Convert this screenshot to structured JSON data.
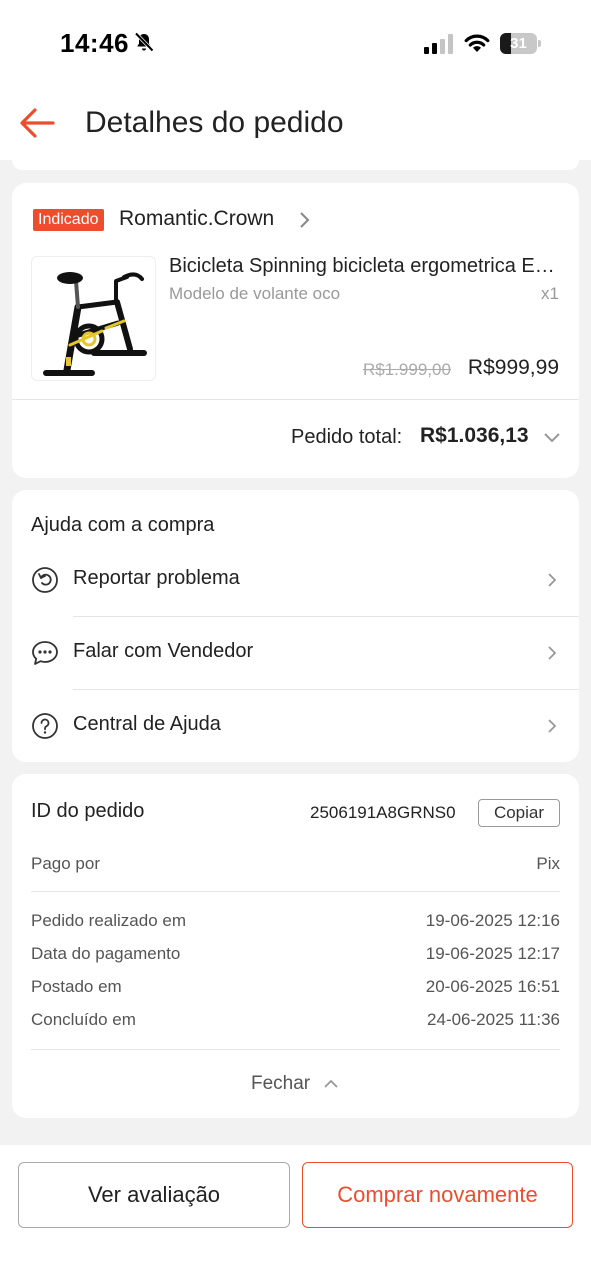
{
  "status_bar": {
    "time": "14:46",
    "battery": "31",
    "battery_level": 0.31
  },
  "header": {
    "title": "Detalhes do pedido"
  },
  "order": {
    "badge": "Indicado",
    "shop_name": "Romantic.Crown",
    "product_title": "Bicicleta Spinning bicicleta ergometrica Ergométrica Bike",
    "variant": "Modelo de volante oco",
    "quantity": "x1",
    "original_price": "R$1.999,00",
    "price": "R$999,99",
    "total_label": "Pedido total:",
    "total_value": "R$1.036,13"
  },
  "help": {
    "title": "Ajuda com a compra",
    "items": [
      {
        "label": "Reportar problema",
        "icon": "report-problem-icon"
      },
      {
        "label": "Falar com Vendedor",
        "icon": "chat-icon"
      },
      {
        "label": "Central de Ajuda",
        "icon": "help-question-icon"
      }
    ]
  },
  "order_info": {
    "id_label": "ID do pedido",
    "id_value": "2506191A8GRNS0",
    "copy_label": "Copiar",
    "paid_by_label": "Pago por",
    "paid_by_value": "Pix",
    "rows": [
      {
        "label": "Pedido realizado em",
        "value": "19-06-2025 12:16"
      },
      {
        "label": "Data do pagamento",
        "value": "19-06-2025 12:17"
      },
      {
        "label": "Postado em",
        "value": "20-06-2025 16:51"
      },
      {
        "label": "Concluído em",
        "value": "24-06-2025 11:36"
      }
    ],
    "close_label": "Fechar"
  },
  "actions": {
    "review_label": "Ver avaliação",
    "buy_again_label": "Comprar novamente"
  },
  "colors": {
    "accent": "#ee4d2d",
    "background": "#f2f2f2"
  }
}
